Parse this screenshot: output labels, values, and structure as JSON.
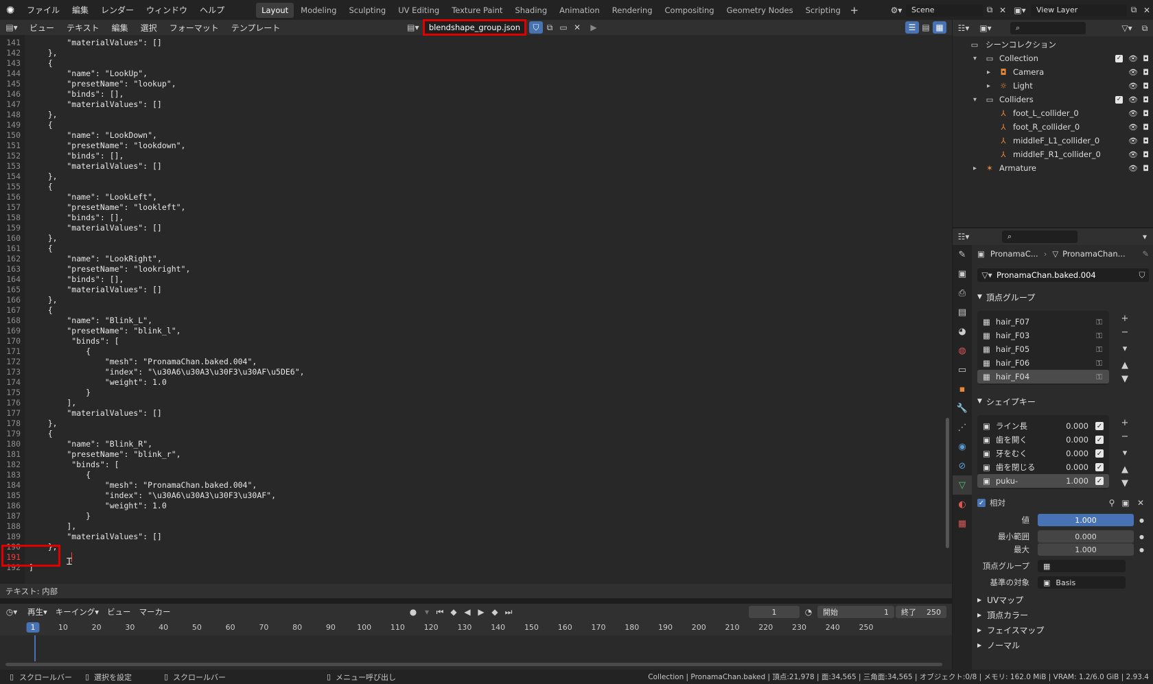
{
  "topbar": {
    "menus": [
      "ファイル",
      "編集",
      "レンダー",
      "ウィンドウ",
      "ヘルプ"
    ],
    "tabs": [
      "Layout",
      "Modeling",
      "Sculpting",
      "UV Editing",
      "Texture Paint",
      "Shading",
      "Animation",
      "Rendering",
      "Compositing",
      "Geometry Nodes",
      "Scripting"
    ],
    "active_tab": "Layout",
    "scene": "Scene",
    "view_layer": "View Layer"
  },
  "editor": {
    "menus": [
      "ビュー",
      "テキスト",
      "編集",
      "選択",
      "フォーマット",
      "テンプレート"
    ],
    "filename": "blendshape_group.json",
    "footer": "テキスト: 内部",
    "lines": [
      {
        "n": "141",
        "t": "        \"materialValues\": []"
      },
      {
        "n": "142",
        "t": "    },"
      },
      {
        "n": "143",
        "t": "    {"
      },
      {
        "n": "144",
        "t": "        \"name\": \"LookUp\","
      },
      {
        "n": "145",
        "t": "        \"presetName\": \"lookup\","
      },
      {
        "n": "146",
        "t": "        \"binds\": [],"
      },
      {
        "n": "147",
        "t": "        \"materialValues\": []"
      },
      {
        "n": "148",
        "t": "    },"
      },
      {
        "n": "149",
        "t": "    {"
      },
      {
        "n": "150",
        "t": "        \"name\": \"LookDown\","
      },
      {
        "n": "151",
        "t": "        \"presetName\": \"lookdown\","
      },
      {
        "n": "152",
        "t": "        \"binds\": [],"
      },
      {
        "n": "153",
        "t": "        \"materialValues\": []"
      },
      {
        "n": "154",
        "t": "    },"
      },
      {
        "n": "155",
        "t": "    {"
      },
      {
        "n": "156",
        "t": "        \"name\": \"LookLeft\","
      },
      {
        "n": "157",
        "t": "        \"presetName\": \"lookleft\","
      },
      {
        "n": "158",
        "t": "        \"binds\": [],"
      },
      {
        "n": "159",
        "t": "        \"materialValues\": []"
      },
      {
        "n": "160",
        "t": "    },"
      },
      {
        "n": "161",
        "t": "    {"
      },
      {
        "n": "162",
        "t": "        \"name\": \"LookRight\","
      },
      {
        "n": "163",
        "t": "        \"presetName\": \"lookright\","
      },
      {
        "n": "164",
        "t": "        \"binds\": [],"
      },
      {
        "n": "165",
        "t": "        \"materialValues\": []"
      },
      {
        "n": "166",
        "t": "    },"
      },
      {
        "n": "167",
        "t": "    {"
      },
      {
        "n": "168",
        "t": "        \"name\": \"Blink_L\","
      },
      {
        "n": "169",
        "t": "        \"presetName\": \"blink_l\","
      },
      {
        "n": "170",
        "t": "         \"binds\": ["
      },
      {
        "n": "171",
        "t": "            {"
      },
      {
        "n": "172",
        "t": "                \"mesh\": \"PronamaChan.baked.004\","
      },
      {
        "n": "173",
        "t": "                \"index\": \"\\u30A6\\u30A3\\u30F3\\u30AF\\u5DE6\","
      },
      {
        "n": "174",
        "t": "                \"weight\": 1.0"
      },
      {
        "n": "175",
        "t": "            }"
      },
      {
        "n": "176",
        "t": "        ],"
      },
      {
        "n": "177",
        "t": "        \"materialValues\": []"
      },
      {
        "n": "178",
        "t": "    },"
      },
      {
        "n": "179",
        "t": "    {"
      },
      {
        "n": "180",
        "t": "        \"name\": \"Blink_R\","
      },
      {
        "n": "181",
        "t": "        \"presetName\": \"blink_r\","
      },
      {
        "n": "182",
        "t": "         \"binds\": ["
      },
      {
        "n": "183",
        "t": "            {"
      },
      {
        "n": "184",
        "t": "                \"mesh\": \"PronamaChan.baked.004\","
      },
      {
        "n": "185",
        "t": "                \"index\": \"\\u30A6\\u30A3\\u30F3\\u30AF\","
      },
      {
        "n": "186",
        "t": "                \"weight\": 1.0"
      },
      {
        "n": "187",
        "t": "            }"
      },
      {
        "n": "188",
        "t": "        ],"
      },
      {
        "n": "189",
        "t": "        \"materialValues\": []"
      },
      {
        "n": "190",
        "t": "    },"
      },
      {
        "n": "191",
        "t": ""
      },
      {
        "n": "192",
        "t": "]"
      }
    ]
  },
  "timeline": {
    "menus": [
      "再生",
      "キーイング",
      "ビュー",
      "マーカー"
    ],
    "current_frame": "1",
    "start_label": "開始",
    "start": "1",
    "end_label": "終了",
    "end": "250",
    "ticks": [
      "1",
      "10",
      "20",
      "30",
      "40",
      "50",
      "60",
      "70",
      "80",
      "90",
      "100",
      "110",
      "120",
      "130",
      "140",
      "150",
      "160",
      "170",
      "180",
      "190",
      "200",
      "210",
      "220",
      "230",
      "240",
      "250"
    ]
  },
  "statusbar": {
    "items": [
      "スクロールバー",
      "選択を設定",
      "スクロールバー",
      "メニュー呼び出し"
    ],
    "info": "Collection | PronamaChan.baked | 頂点:21,978 | 面:34,565 | 三角面:34,565 | オブジェクト:0/8 | メモリ: 162.0 MiB | VRAM: 1.2/6.0 GiB | 2.93.4"
  },
  "outliner": {
    "root": "シーンコレクション",
    "rows": [
      {
        "label": "Collection",
        "indent": 1,
        "arrow": "▾",
        "icon": "collection-icon",
        "check": true
      },
      {
        "label": "Camera",
        "indent": 2,
        "arrow": "▸",
        "icon": "camera-icon"
      },
      {
        "label": "Light",
        "indent": 2,
        "arrow": "▸",
        "icon": "light-icon"
      },
      {
        "label": "Colliders",
        "indent": 1,
        "arrow": "▾",
        "icon": "collection-icon",
        "check": true
      },
      {
        "label": "foot_L_collider_0",
        "indent": 2,
        "arrow": "",
        "icon": "empty-icon"
      },
      {
        "label": "foot_R_collider_0",
        "indent": 2,
        "arrow": "",
        "icon": "empty-icon"
      },
      {
        "label": "middleF_L1_collider_0",
        "indent": 2,
        "arrow": "",
        "icon": "empty-icon"
      },
      {
        "label": "middleF_R1_collider_0",
        "indent": 2,
        "arrow": "",
        "icon": "empty-icon"
      },
      {
        "label": "Armature",
        "indent": 1,
        "arrow": "▸",
        "icon": "armature-icon"
      }
    ]
  },
  "props": {
    "breadcrumb1": "PronamaC...",
    "breadcrumb2": "PronamaChan...",
    "mesh_name": "PronamaChan.baked.004",
    "vgroup_title": "頂点グループ",
    "vgroups": [
      "hair_F07",
      "hair_F03",
      "hair_F05",
      "hair_F06",
      "hair_F04"
    ],
    "shapekey_title": "シェイプキー",
    "shapekeys": [
      {
        "name": "ライン長",
        "value": "0.000"
      },
      {
        "name": "歯を開く",
        "value": "0.000"
      },
      {
        "name": "牙をむく",
        "value": "0.000"
      },
      {
        "name": "歯を閉じる",
        "value": "0.000"
      },
      {
        "name": "puku-",
        "value": "1.000"
      }
    ],
    "relative_label": "相対",
    "value_label": "値",
    "value": "1.000",
    "min_label": "最小範囲",
    "min": "0.000",
    "max_label": "最大",
    "max": "1.000",
    "vg_label": "頂点グループ",
    "basis_label": "基準の対象",
    "basis": "Basis",
    "sections": [
      "UVマップ",
      "頂点カラー",
      "フェイスマップ",
      "ノーマル"
    ]
  }
}
